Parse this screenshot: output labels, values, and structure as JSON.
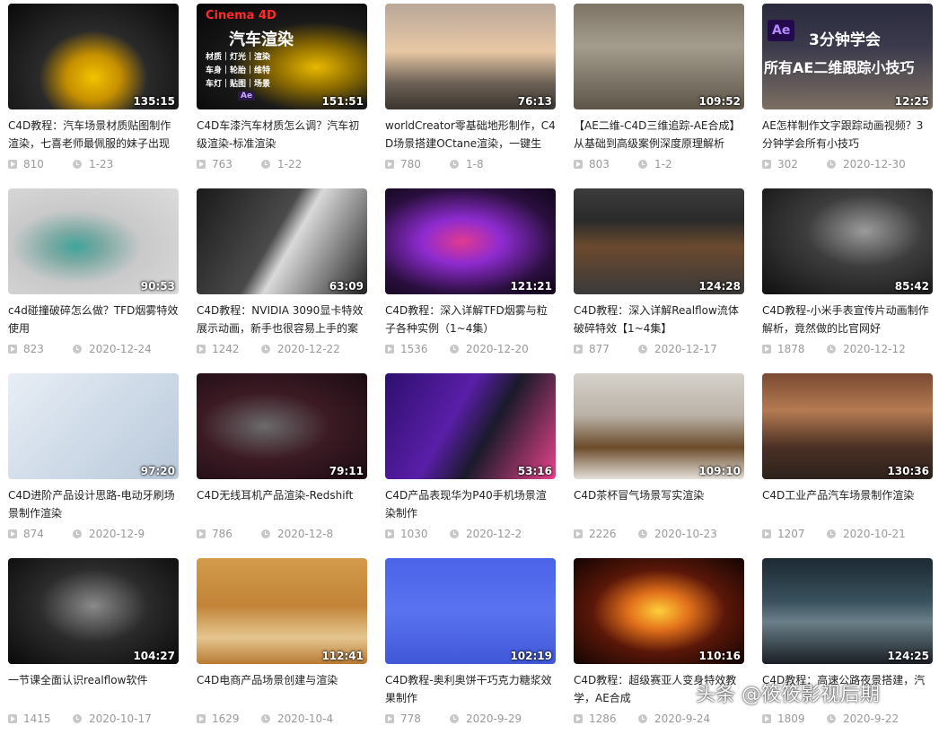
{
  "videos": [
    {
      "title": "C4D教程：汽车场景材质贴图制作渲染，七喜老师最佩服的妹子出现",
      "duration": "135:15",
      "views": "810",
      "date": "1-23",
      "overlay": []
    },
    {
      "title": "C4D车漆汽车材质怎么调？汽车初级渲染-标准渲染",
      "duration": "151:51",
      "views": "763",
      "date": "1-22",
      "overlay": [
        "Cinema 4D",
        "汽车渲染",
        "材质｜灯光｜渲染",
        "车身｜轮胎｜维特",
        "车灯｜贴图｜场景",
        "Ae"
      ]
    },
    {
      "title": "worldCreator零基础地形制作，C4D场景搭建OCtane渲染，一键生",
      "duration": "76:13",
      "views": "780",
      "date": "1-8",
      "overlay": []
    },
    {
      "title": "【AE二维-C4D三维追踪-AE合成】从基础到高级案例深度原理解析",
      "duration": "109:52",
      "views": "803",
      "date": "1-2",
      "overlay": []
    },
    {
      "title": "AE怎样制作文字跟踪动画视频？3分钟学会所有小技巧",
      "duration": "12:25",
      "views": "302",
      "date": "2020-12-30",
      "overlay": [
        "Ae",
        "3分钟学会",
        "所有AE二维跟踪小技巧"
      ]
    },
    {
      "title": "c4d碰撞破碎怎么做？TFD烟雾特效使用",
      "duration": "90:53",
      "views": "823",
      "date": "2020-12-24",
      "overlay": []
    },
    {
      "title": "C4D教程：NVIDIA 3090显卡特效展示动画，新手也很容易上手的案",
      "duration": "63:09",
      "views": "1242",
      "date": "2020-12-22",
      "overlay": []
    },
    {
      "title": "C4D教程：深入详解TFD烟雾与粒子各种实例（1~4集）",
      "duration": "121:21",
      "views": "1536",
      "date": "2020-12-20",
      "overlay": []
    },
    {
      "title": "C4D教程：深入详解Realflow流体破碎特效【1~4集】",
      "duration": "124:28",
      "views": "877",
      "date": "2020-12-17",
      "overlay": []
    },
    {
      "title": "C4D教程-小米手表宣传片动画制作解析，竟然做的比官网好",
      "duration": "85:42",
      "views": "1878",
      "date": "2020-12-12",
      "overlay": []
    },
    {
      "title": "C4D进阶产品设计思路-电动牙刷场景制作渲染",
      "duration": "97:20",
      "views": "874",
      "date": "2020-12-9",
      "overlay": []
    },
    {
      "title": "C4D无线耳机产品渲染-Redshift",
      "duration": "79:11",
      "views": "786",
      "date": "2020-12-8",
      "overlay": []
    },
    {
      "title": "C4D产品表现华为P40手机场景渲染制作",
      "duration": "53:16",
      "views": "1030",
      "date": "2020-12-2",
      "overlay": []
    },
    {
      "title": "C4D茶杯冒气场景写实渲染",
      "duration": "109:10",
      "views": "2226",
      "date": "2020-10-23",
      "overlay": []
    },
    {
      "title": "C4D工业产品汽车场景制作渲染",
      "duration": "130:36",
      "views": "1207",
      "date": "2020-10-21",
      "overlay": []
    },
    {
      "title": "一节课全面认识realflow软件",
      "duration": "104:27",
      "views": "1415",
      "date": "2020-10-17",
      "overlay": []
    },
    {
      "title": "C4D电商产品场景创建与渲染",
      "duration": "112:41",
      "views": "1629",
      "date": "2020-10-4",
      "overlay": []
    },
    {
      "title": "C4D教程-奥利奥饼干巧克力糖浆效果制作",
      "duration": "102:19",
      "views": "778",
      "date": "2020-9-29",
      "overlay": []
    },
    {
      "title": "C4D教程：超级赛亚人变身特效教学，AE合成",
      "duration": "110:16",
      "views": "1286",
      "date": "2020-9-24",
      "overlay": []
    },
    {
      "title": "C4D教程：高速公路夜景搭建，汽",
      "duration": "124:25",
      "views": "1809",
      "date": "2020-9-22",
      "overlay": []
    }
  ],
  "watermark": "头条 @筱筱影视后期"
}
